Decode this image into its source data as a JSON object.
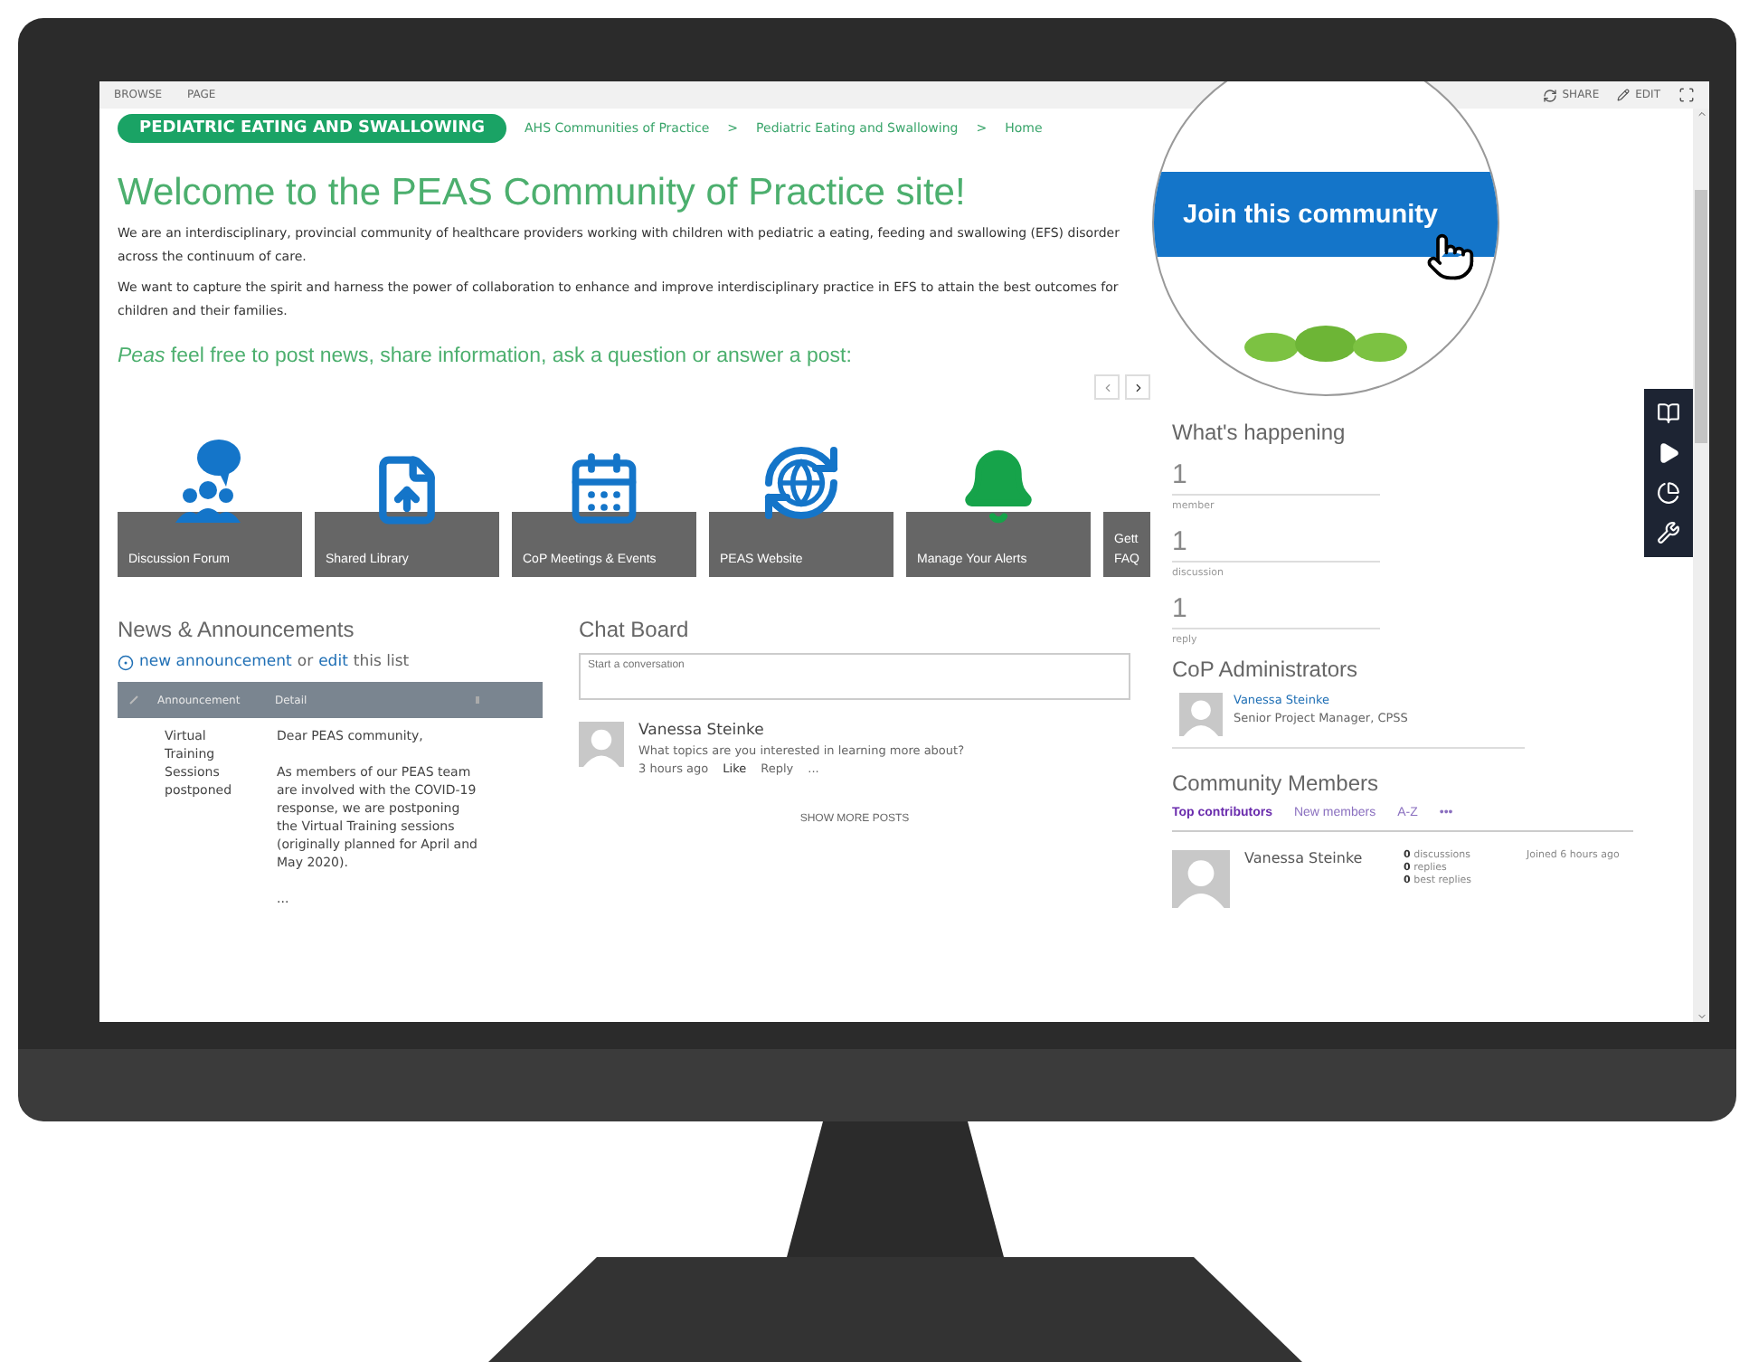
{
  "ribbon": {
    "links": [
      "BROWSE",
      "PAGE"
    ],
    "actions": [
      {
        "kind": "share",
        "label": "SHARE"
      },
      {
        "kind": "edit",
        "label": "EDIT"
      },
      {
        "kind": "focus"
      }
    ]
  },
  "site_badge": "PEDIATRIC EATING AND SWALLOWING",
  "breadcrumb": {
    "items": [
      "AHS Communities of Practice",
      "Pediatric Eating and Swallowing",
      "Home"
    ],
    "separator": ">"
  },
  "title": "Welcome to the PEAS Community of Practice site!",
  "intro": [
    "We are an interdisciplinary, provincial community of healthcare providers working with children with pediatric a eating, feeding and swallowing (EFS) disorder across the continuum of care.",
    "We want to capture the spirit and harness the power of collaboration to enhance and improve interdisciplinary practice in EFS to attain the best outcomes for children and their families."
  ],
  "invite": "*Peas* feel free to post news, share information, ask a question or answer a post:",
  "tiles": [
    {
      "kind": "forum",
      "label": "Discussion Forum"
    },
    {
      "kind": "library",
      "label": "Shared Library"
    },
    {
      "kind": "calendar",
      "label": "CoP Meetings & Events"
    },
    {
      "kind": "website",
      "label": "PEAS Website"
    },
    {
      "kind": "alerts",
      "label": "Manage Your Alerts"
    },
    {
      "kind": "cut",
      "label": "Gett FAQ"
    }
  ],
  "news": {
    "title": "News & Announcements",
    "new_link": "new announcement",
    "or": "or",
    "edit_link": "edit",
    "rest": "this list",
    "columns": [
      "Announcement",
      "Detail"
    ],
    "rows": [
      {
        "announcement": "Virtual Training Sessions postponed",
        "detail": [
          "Dear PEAS community,",
          "As members of our PEAS team are involved with the COVID-19 response, we are postponing the Virtual Training sessions (originally planned for April and May 2020).",
          "..."
        ]
      }
    ]
  },
  "chat": {
    "title": "Chat Board",
    "placeholder": "Start a conversation",
    "posts": [
      {
        "author": "Vanessa Steinke",
        "text": "What topics are you interested in learning more about?",
        "time": "3 hours ago",
        "actions": [
          "Like",
          "Reply",
          "..."
        ]
      }
    ],
    "more": "SHOW MORE POSTS"
  },
  "join_button": "Join this community",
  "stats": {
    "title": "What's happening",
    "items": [
      {
        "value": "1",
        "label": "member"
      },
      {
        "value": "1",
        "label": "discussion"
      },
      {
        "value": "1",
        "label": "reply"
      }
    ]
  },
  "admins": {
    "title": "CoP Administrators",
    "people": [
      {
        "name": "Vanessa Steinke",
        "role": "Senior Project Manager, CPSS"
      }
    ]
  },
  "members": {
    "title": "Community Members",
    "tabs": [
      {
        "label": "Top contributors",
        "selected": true
      },
      {
        "label": "New members",
        "selected": false
      },
      {
        "label": "A-Z",
        "selected": false
      }
    ],
    "more": "•••",
    "people": [
      {
        "name": "Vanessa Steinke",
        "stats": [
          "**0** discussions",
          "**0** replies",
          "**0** best replies"
        ],
        "joined": "Joined 6 hours ago"
      }
    ]
  }
}
